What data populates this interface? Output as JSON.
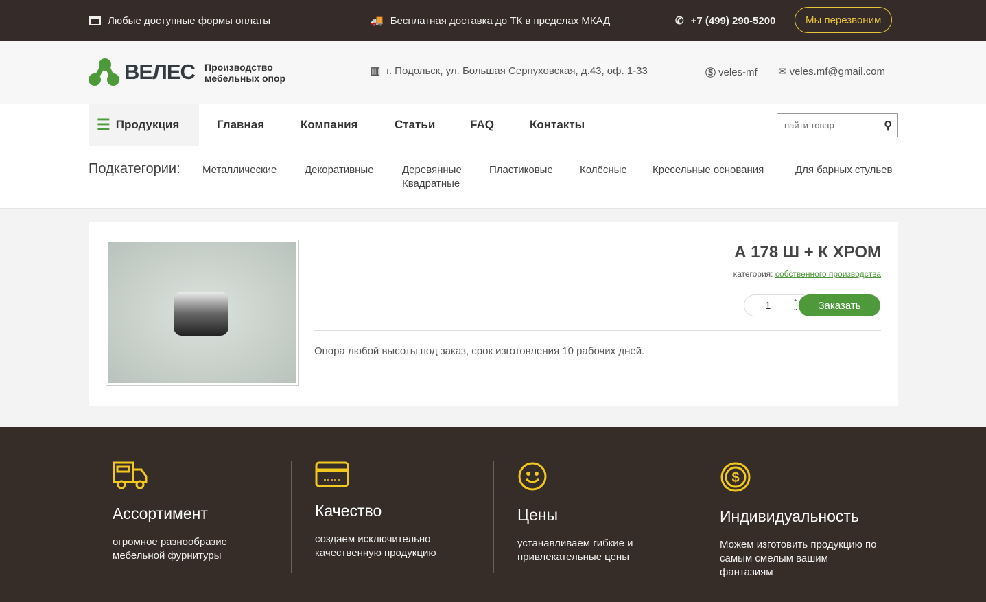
{
  "topbar": {
    "payment": "Любые доступные формы оплаты",
    "delivery": "Бесплатная доставка до ТК в пределах МКАД",
    "phone": "+7 (499) 290-5200",
    "callback": "Мы перезвоним"
  },
  "header": {
    "logo": "ВЕЛЕС",
    "tagline1": "Производство",
    "tagline2": "мебельных опор",
    "address": "г. Подольск, ул. Большая Серпуховская, д.43, оф. 1-33",
    "skype": "veles-mf",
    "email": "veles.mf@gmail.com"
  },
  "nav": {
    "products": "Продукция",
    "items": [
      "Главная",
      "Компания",
      "Статьи",
      "FAQ",
      "Контакты"
    ],
    "search_placeholder": "найти товар"
  },
  "subcats": {
    "label": "Подкатегории:",
    "items": [
      "Металлические",
      "Декоративные",
      "Деревянные",
      "Квадратные",
      "Пластиковые",
      "Колёсные",
      "Кресельные основания",
      "Для барных стульев"
    ]
  },
  "product": {
    "title": "А 178 Ш + К ХРОМ",
    "category_label": "категория:",
    "category": "собственного производства",
    "qty": "1",
    "order": "Заказать",
    "description": "Опора любой высоты под заказ, срок изготовления 10 рабочих дней."
  },
  "features": [
    {
      "title": "Ассортимент",
      "text": "огромное разнообразие мебельной фурнитуры"
    },
    {
      "title": "Качество",
      "text": "создаем исключительно качественную продукцию"
    },
    {
      "title": "Цены",
      "text": "устанавливаем гибкие и привлекательные цены"
    },
    {
      "title": "Индивидуальность",
      "text": "Можем изготовить продукцию по самым смелым вашим фантазиям"
    }
  ],
  "colors": {
    "green": "#4e9a3a",
    "yellow": "#f1c81f",
    "dark": "#362d29"
  }
}
